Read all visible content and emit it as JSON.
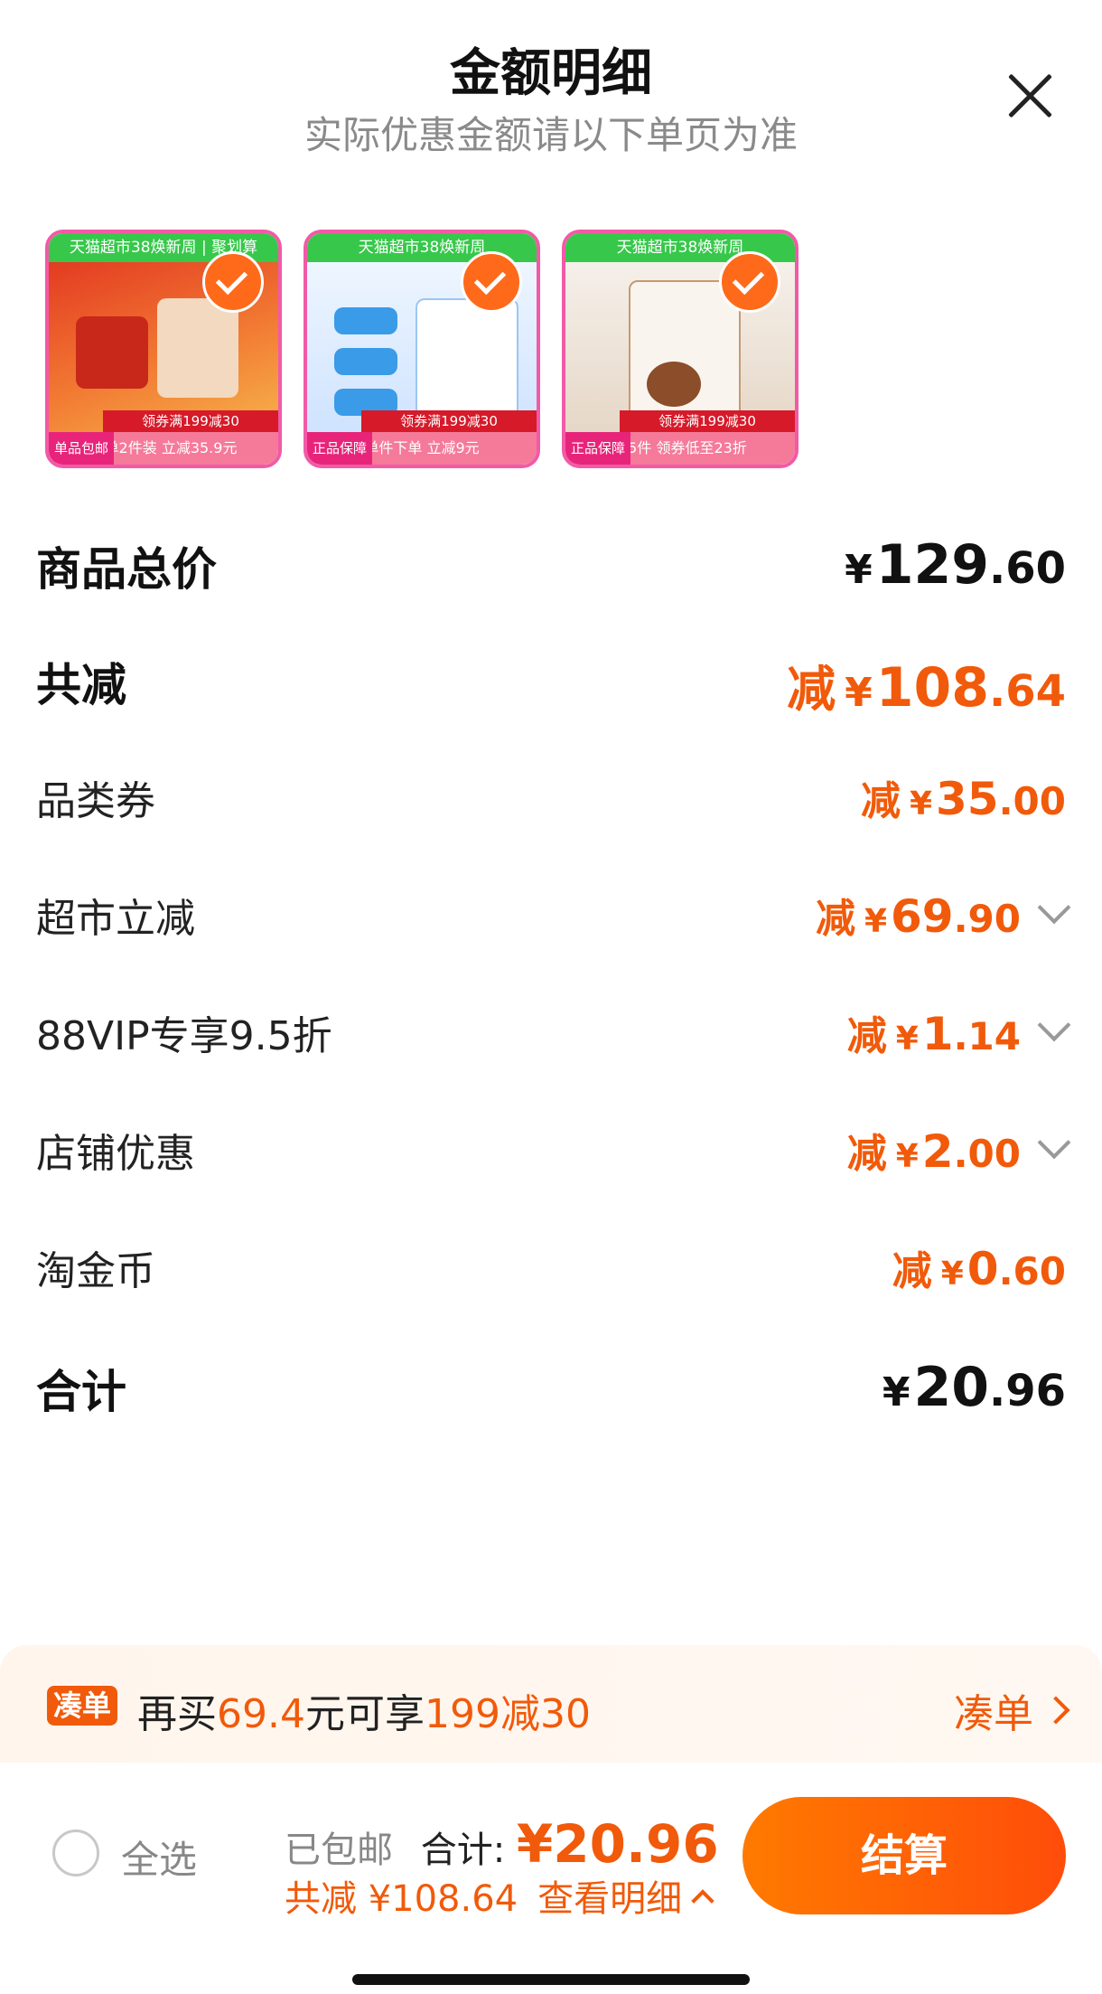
{
  "header": {
    "title": "金额明细",
    "subtitle": "实际优惠金额请以下单页为准",
    "close_icon": "close-icon"
  },
  "products": [
    {
      "band": "天猫超市38焕新周 | 聚划算",
      "promo": "领券满199减30",
      "tag": "单品包邮",
      "footer": "下单2件装 立减35.9元"
    },
    {
      "band": "天猫超市38焕新周",
      "promo": "领券满199减30",
      "tag": "正品保障",
      "footer": "单件下单 立减9元"
    },
    {
      "band": "天猫超市38焕新周",
      "promo": "领券满199减30",
      "tag": "正品保障",
      "footer": "拍5件 领券低至23折"
    }
  ],
  "summary": {
    "total": {
      "label": "商品总价",
      "yen": "¥",
      "int": "129",
      "dec": ".60"
    },
    "discount": {
      "label": "共减",
      "prefix": "减",
      "yen": "¥",
      "int": "108",
      "dec": ".64"
    },
    "items": [
      {
        "label": "品类券",
        "prefix": "减",
        "yen": "¥",
        "int": "35",
        "dec": ".00",
        "expandable": false
      },
      {
        "label": "超市立减",
        "prefix": "减",
        "yen": "¥",
        "int": "69",
        "dec": ".90",
        "expandable": true
      },
      {
        "label": "88VIP专享9.5折",
        "prefix": "减",
        "yen": "¥",
        "int": "1",
        "dec": ".14",
        "expandable": true
      },
      {
        "label": "店铺优惠",
        "prefix": "减",
        "yen": "¥",
        "int": "2",
        "dec": ".00",
        "expandable": true
      },
      {
        "label": "淘金币",
        "prefix": "减",
        "yen": "¥",
        "int": "0",
        "dec": ".60",
        "expandable": false
      }
    ],
    "final": {
      "label": "合计",
      "yen": "¥",
      "int": "20",
      "dec": ".96"
    }
  },
  "coupon_bar": {
    "badge": "凑单",
    "text_a": "再买",
    "text_amount": "69.4",
    "text_b": "元可享",
    "text_offer": "199减30",
    "link": "凑单"
  },
  "bottom_bar": {
    "select_all": "全选",
    "shipping": "已包邮",
    "total_label": "合计:",
    "total_value": "¥20.96",
    "saved_label": "共减 ¥108.64",
    "detail_link": "查看明细",
    "checkout": "结算"
  },
  "colors": {
    "accent": "#f15a0a",
    "checkout_start": "#ff7a00",
    "checkout_end": "#ff4d0a"
  }
}
